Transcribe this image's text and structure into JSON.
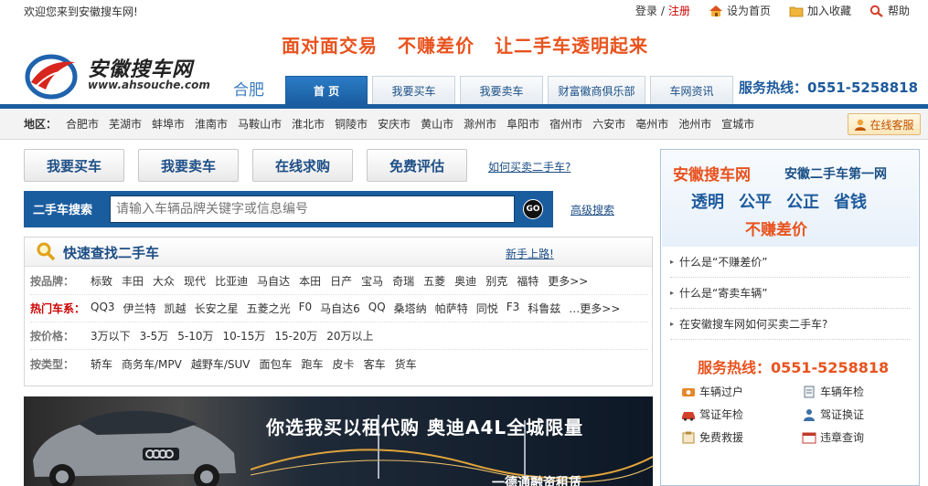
{
  "topbar": {
    "welcome": "欢迎您来到安徽搜车网!",
    "login": "登录",
    "separator": "/",
    "register": "注册",
    "set_home": "设为首页",
    "add_fav": "加入收藏",
    "help": "帮助"
  },
  "header": {
    "logo_name": "安徽搜车网",
    "logo_url": "www.ahsouche.com",
    "city": "合肥",
    "slogans": [
      "面对面交易",
      "不赚差价",
      "让二手车透明起来"
    ],
    "hotline": "服务热线：0551-5258818"
  },
  "nav": {
    "tabs": [
      {
        "label": "首 页",
        "active": true
      },
      {
        "label": "我要买车",
        "active": false
      },
      {
        "label": "我要卖车",
        "active": false
      },
      {
        "label": "财富徽商俱乐部",
        "active": false
      },
      {
        "label": "车网资讯",
        "active": false
      }
    ]
  },
  "region": {
    "label": "地区：",
    "cities": [
      "合肥市",
      "芜湖市",
      "蚌埠市",
      "淮南市",
      "马鞍山市",
      "淮北市",
      "铜陵市",
      "安庆市",
      "黄山市",
      "滁州市",
      "阜阳市",
      "宿州市",
      "六安市",
      "亳州市",
      "池州市",
      "宣城市"
    ],
    "service": "在线客服"
  },
  "actions": {
    "buy": "我要买车",
    "sell": "我要卖车",
    "seek": "在线求购",
    "evaluate": "免费评估",
    "howto": "如何买卖二手车?"
  },
  "search": {
    "label": "二手车搜索",
    "placeholder": "请输入车辆品牌关键字或信息编号",
    "go": "GO",
    "advanced": "高级搜索"
  },
  "quick": {
    "title": "快速查找二手车",
    "newbie": "新手上路!",
    "rows": [
      {
        "label": "按品牌：",
        "items": [
          "标致",
          "丰田",
          "大众",
          "现代",
          "比亚迪",
          "马自达",
          "本田",
          "日产",
          "宝马",
          "奇瑞",
          "五菱",
          "奥迪",
          "别克",
          "福特",
          "更多>>"
        ]
      },
      {
        "label": "热门车系：",
        "items": [
          "QQ3",
          "伊兰特",
          "凯越",
          "长安之星",
          "五菱之光",
          "F0",
          "马自达6",
          "QQ",
          "桑塔纳",
          "帕萨特",
          "同悦",
          "F3",
          "科鲁兹",
          "…更多>>"
        ]
      },
      {
        "label": "按价格：",
        "items": [
          "3万以下",
          "3-5万",
          "5-10万",
          "10-15万",
          "15-20万",
          "20万以上"
        ]
      },
      {
        "label": "按类型：",
        "items": [
          "轿车",
          "商务车/MPV",
          "越野车/SUV",
          "面包车",
          "跑车",
          "皮卡",
          "客车",
          "货车"
        ]
      }
    ]
  },
  "banner": {
    "headline": "你选我买以租代购  奥迪A4L全城限量",
    "tagline": "一德通融资租赁"
  },
  "right": {
    "brand": "安徽搜车网",
    "subtitle": "安徽二手车第一网",
    "words": [
      "透明",
      "公平",
      "公正",
      "省钱"
    ],
    "nomark": "不赚差价",
    "qa": [
      "什么是“不赚差价”",
      "什么是“寄卖车辆”",
      "在安徽搜车网如何买卖二手车?"
    ],
    "hotline": "服务热线：0551-5258818",
    "services": [
      "车辆过户",
      "车辆年检",
      "驾证年检",
      "驾证换证",
      "免费救援",
      "违章查询"
    ]
  }
}
